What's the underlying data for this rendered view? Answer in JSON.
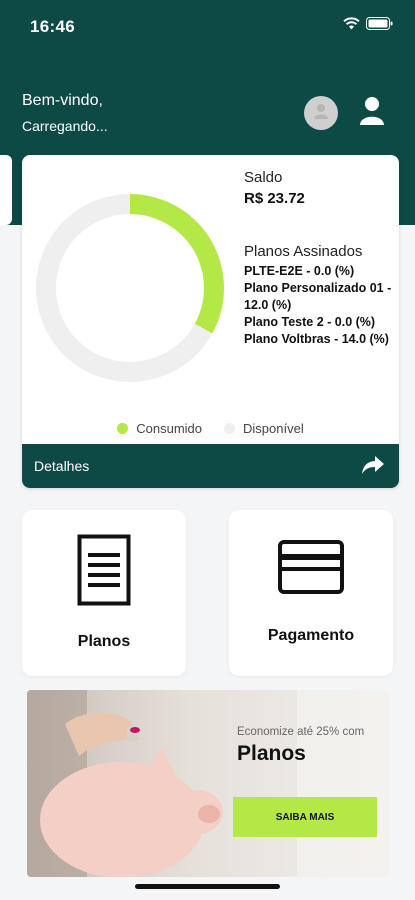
{
  "status_bar": {
    "time": "16:46"
  },
  "header": {
    "greeting": "Bem-vindo,",
    "subtitle": "Carregando..."
  },
  "balance": {
    "label": "Saldo",
    "value": "R$ 23.72",
    "consumed_fraction": 0.33
  },
  "plans": {
    "title": "Planos Assinados",
    "items": [
      "PLTE-E2E - 0.0 (%)",
      "Plano Personalizado 01 - 12.0 (%)",
      "Plano Teste 2 - 0.0 (%)",
      "Plano Voltbras - 14.0 (%)"
    ]
  },
  "legend": {
    "consumed": "Consumido",
    "available": "Disponível"
  },
  "details": {
    "label": "Detalhes"
  },
  "tiles": {
    "planos": "Planos",
    "pagamento": "Pagamento"
  },
  "promo": {
    "subtitle": "Economize até 25% com",
    "title": "Planos",
    "button": "SAIBA MAIS"
  },
  "colors": {
    "brand": "#0e4a45",
    "accent": "#b4e846",
    "track": "#efefef"
  }
}
